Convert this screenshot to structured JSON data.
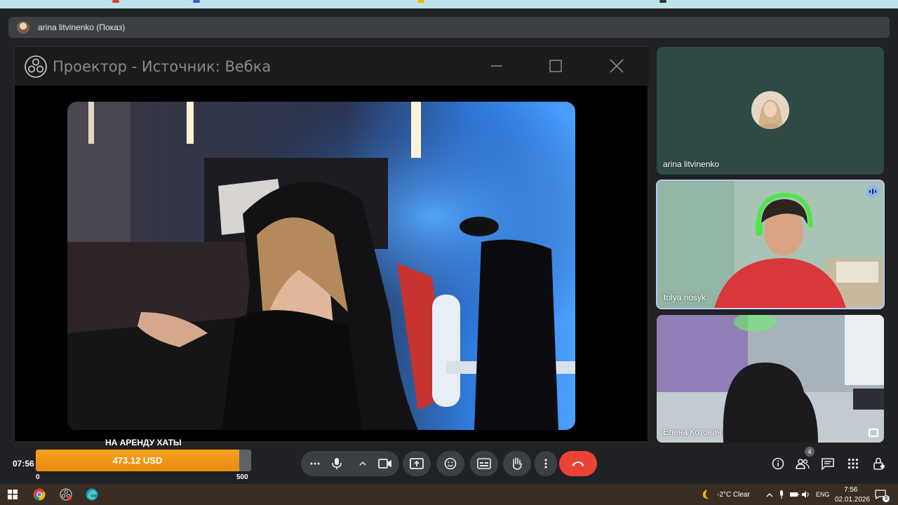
{
  "meeting": {
    "presenter_title": "arina litvinenko (Показ)",
    "clock": "07:56"
  },
  "projector": {
    "title": "Проектор - Источник: Вебка"
  },
  "participants": [
    {
      "name": "arina litvinenko"
    },
    {
      "name": "tolya nosyk"
    },
    {
      "name": "Елена Котович"
    }
  ],
  "donation_goal": {
    "title": "НА АРЕНДУ ХАТЫ",
    "amount": "473.12 USD",
    "min_label": "0",
    "max_label": "500",
    "progress_fraction": 0.946
  },
  "toolbar": {
    "people_count": "4"
  },
  "taskbar": {
    "weather": "-2°C  Clear",
    "language": "ENG",
    "time": "7:56",
    "date": "02.01.2026",
    "notifications": "9"
  },
  "colors": {
    "end_call": "#ea4335",
    "goal_fill": "#f39c19",
    "speaking_ring": "#b8c8f8"
  }
}
